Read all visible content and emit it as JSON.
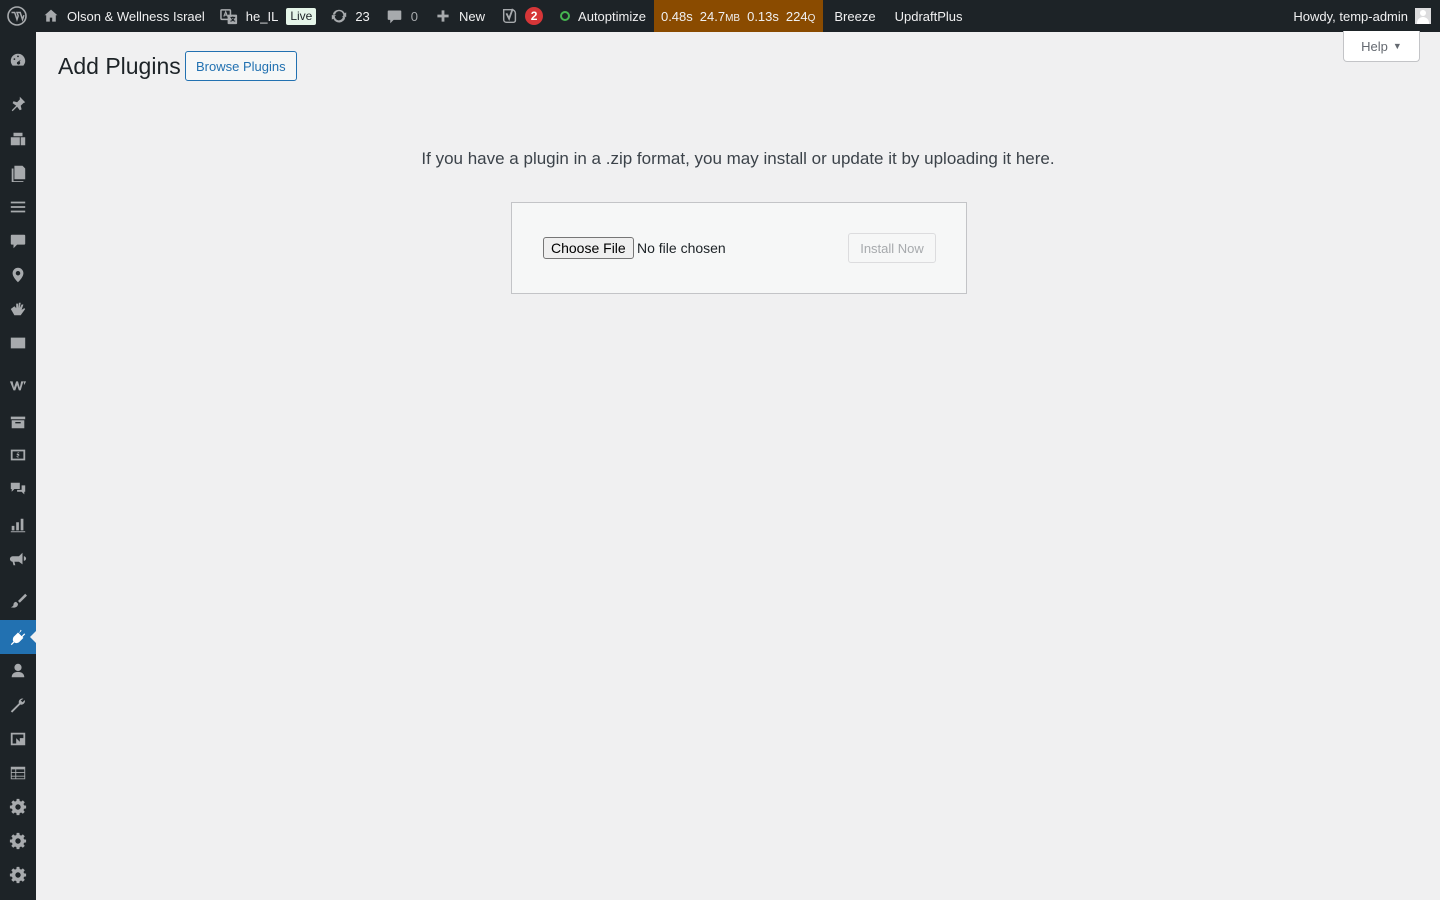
{
  "adminbar": {
    "site_name": "Olson & Wellness Israel",
    "language": "he_IL",
    "live_label": "Live",
    "updates_count": "23",
    "comments_count": "0",
    "new_label": "New",
    "yoast_count": "2",
    "autoptimize_label": "Autoptimize",
    "qm": {
      "time": "0.48s",
      "memory": "24.7",
      "memory_unit": "MB",
      "db_time": "0.13s",
      "queries": "224",
      "queries_unit": "Q"
    },
    "breeze_label": "Breeze",
    "updraft_label": "UpdraftPlus",
    "greeting": "Howdy, temp-admin"
  },
  "sidebar": {
    "items": [
      {
        "icon": "dashboard-icon"
      },
      {
        "icon": "posts-pin-icon"
      },
      {
        "icon": "media-icon"
      },
      {
        "icon": "pages-icon"
      },
      {
        "icon": "menu-list-icon"
      },
      {
        "icon": "comments-icon"
      },
      {
        "icon": "location-pin-icon"
      },
      {
        "icon": "hand-icon"
      },
      {
        "icon": "mail-icon"
      },
      {
        "icon": "woocommerce-icon"
      },
      {
        "icon": "archive-icon"
      },
      {
        "icon": "money-icon"
      },
      {
        "icon": "chat-bubbles-icon"
      },
      {
        "icon": "analytics-icon"
      },
      {
        "icon": "megaphone-icon"
      },
      {
        "icon": "appearance-brush-icon"
      },
      {
        "icon": "plugins-icon",
        "current": true
      },
      {
        "icon": "users-icon"
      },
      {
        "icon": "tools-wrench-icon"
      },
      {
        "icon": "import-icon"
      },
      {
        "icon": "table-icon"
      },
      {
        "icon": "settings-gear-icon"
      },
      {
        "icon": "settings-gear-icon"
      },
      {
        "icon": "settings-gear-icon"
      }
    ]
  },
  "help_tab": {
    "label": "Help",
    "caret": "▼"
  },
  "page": {
    "title": "Add Plugins",
    "browse_button": "Browse Plugins",
    "upload_help": "If you have a plugin in a .zip format, you may install or update it by uploading it here.",
    "choose_file_label": "Choose File",
    "file_status": "No file chosen",
    "install_button": "Install Now"
  },
  "colors": {
    "adminbar_bg": "#1d2327",
    "accent": "#2271b1",
    "qm_bg": "#8a4b00",
    "badge_red": "#d63638",
    "live_bg": "#e5f5e9"
  }
}
